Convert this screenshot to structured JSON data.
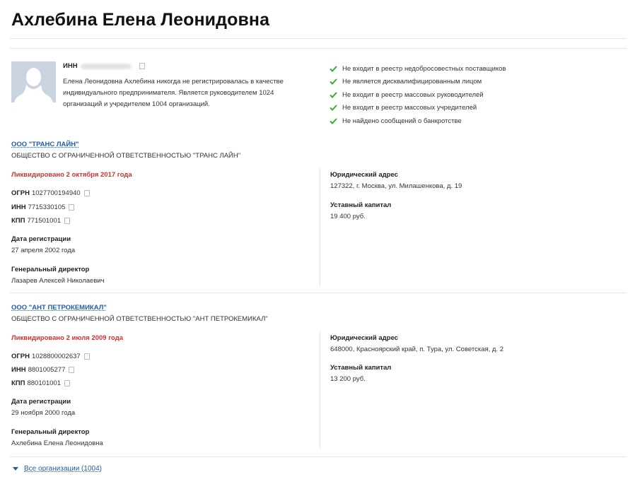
{
  "person": {
    "name": "Ахлебина Елена Леонидовна",
    "inn_label": "ИНН",
    "description": "Елена Леонидовна Ахлебина никогда не регистрировалась в качестве индивидуального предпринимателя. Является руководителем 1024 организаций и учредителем 1004 организаций."
  },
  "checks": [
    "Не входит в реестр недобросовестных поставщиков",
    "Не является дисквалифицированным лицом",
    "Не входит в реестр массовых руководителей",
    "Не входит в реестр массовых учредителей",
    "Не найдено сообщений о банкротстве"
  ],
  "check_color": "#3aaa35",
  "labels": {
    "ogrn": "ОГРН",
    "inn": "ИНН",
    "kpp": "КПП",
    "reg_date": "Дата регистрации",
    "director": "Генеральный директор",
    "address": "Юридический адрес",
    "capital": "Уставный капитал"
  },
  "organizations": [
    {
      "short_name": "ООО \"ТРАНС ЛАЙН\"",
      "full_name": "ОБЩЕСТВО С ОГРАНИЧЕННОЙ ОТВЕТСТВЕННОСТЬЮ \"ТРАНС ЛАЙН\"",
      "status": "Ликвидировано 2 октября 2017 года",
      "ogrn": "1027700194940",
      "inn": "7715330105",
      "kpp": "771501001",
      "reg_date": "27 апреля 2002 года",
      "director": "Лазарев Алексей Николаевич",
      "address": "127322, г. Москва, ул. Милашенкова, д. 19",
      "capital": "19 400 руб."
    },
    {
      "short_name": "ООО \"АНТ ПЕТРОКЕМИКАЛ\"",
      "full_name": "ОБЩЕСТВО С ОГРАНИЧЕННОЙ ОТВЕТСТВЕННОСТЬЮ \"АНТ ПЕТРОКЕМИКАЛ\"",
      "status": "Ликвидировано 2 июля 2009 года",
      "ogrn": "1028800002637",
      "inn": "8801005277",
      "kpp": "880101001",
      "reg_date": "29 ноября 2000 года",
      "director": "Ахлебина Елена Леонидовна",
      "address": "648000, Красноярский край, п. Тура, ул. Советская, д. 2",
      "capital": "13 200 руб."
    }
  ],
  "all_orgs_link": "Все организации (1004)",
  "colors": {
    "link": "#1f5ea8",
    "status": "#d2322d",
    "avatar_bg": "#c9d4e0"
  }
}
